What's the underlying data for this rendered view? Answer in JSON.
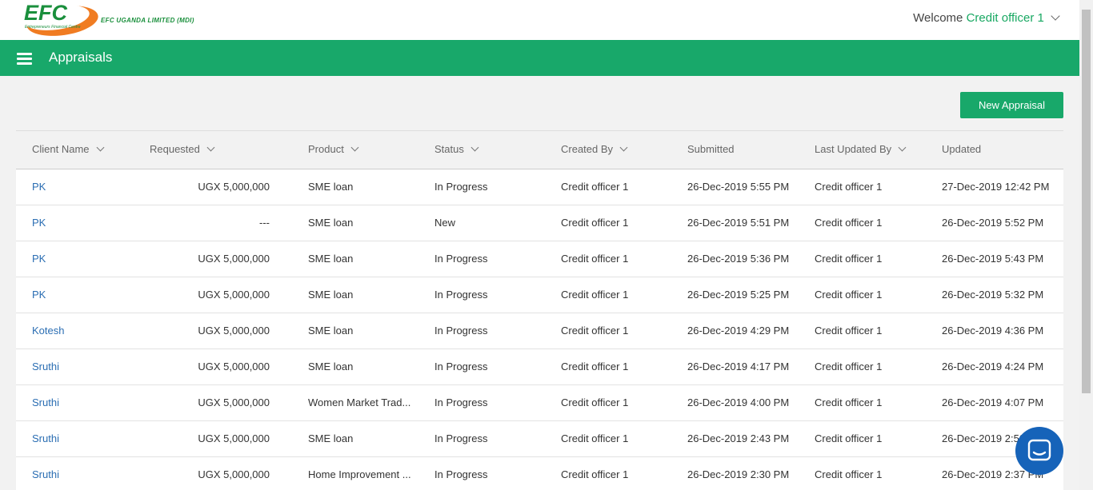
{
  "header": {
    "logo_mark": "EFC",
    "logo_tagline": "Entrepreneurs Financial Centre",
    "company_name": "EFC UGANDA LIMITED (MDI)",
    "welcome_label": "Welcome",
    "user_name": "Credit officer 1"
  },
  "nav": {
    "title": "Appraisals"
  },
  "toolbar": {
    "new_appraisal_label": "New Appraisal"
  },
  "table": {
    "columns": [
      {
        "label": "Client Name",
        "sortable": true
      },
      {
        "label": "Requested",
        "sortable": true
      },
      {
        "label": "Product",
        "sortable": true
      },
      {
        "label": "Status",
        "sortable": true
      },
      {
        "label": "Created By",
        "sortable": true
      },
      {
        "label": "Submitted",
        "sortable": false
      },
      {
        "label": "Last Updated By",
        "sortable": true
      },
      {
        "label": "Updated",
        "sortable": false
      }
    ],
    "rows": [
      {
        "client": "PK",
        "requested": "UGX 5,000,000",
        "product": "SME loan",
        "status": "In Progress",
        "created_by": "Credit officer 1",
        "submitted": "26-Dec-2019 5:55 PM",
        "last_updated_by": "Credit officer 1",
        "updated": "27-Dec-2019 12:42 PM"
      },
      {
        "client": "PK",
        "requested": "---",
        "product": "SME loan",
        "status": "New",
        "created_by": "Credit officer 1",
        "submitted": "26-Dec-2019 5:51 PM",
        "last_updated_by": "Credit officer 1",
        "updated": "26-Dec-2019 5:52 PM"
      },
      {
        "client": "PK",
        "requested": "UGX 5,000,000",
        "product": "SME loan",
        "status": "In Progress",
        "created_by": "Credit officer 1",
        "submitted": "26-Dec-2019 5:36 PM",
        "last_updated_by": "Credit officer 1",
        "updated": "26-Dec-2019 5:43 PM"
      },
      {
        "client": "PK",
        "requested": "UGX 5,000,000",
        "product": "SME loan",
        "status": "In Progress",
        "created_by": "Credit officer 1",
        "submitted": "26-Dec-2019 5:25 PM",
        "last_updated_by": "Credit officer 1",
        "updated": "26-Dec-2019 5:32 PM"
      },
      {
        "client": "Kotesh",
        "requested": "UGX 5,000,000",
        "product": "SME loan",
        "status": "In Progress",
        "created_by": "Credit officer 1",
        "submitted": "26-Dec-2019 4:29 PM",
        "last_updated_by": "Credit officer 1",
        "updated": "26-Dec-2019 4:36 PM"
      },
      {
        "client": "Sruthi",
        "requested": "UGX 5,000,000",
        "product": "SME loan",
        "status": "In Progress",
        "created_by": "Credit officer 1",
        "submitted": "26-Dec-2019 4:17 PM",
        "last_updated_by": "Credit officer 1",
        "updated": "26-Dec-2019 4:24 PM"
      },
      {
        "client": "Sruthi",
        "requested": "UGX 5,000,000",
        "product": "Women Market Trad...",
        "status": "In Progress",
        "created_by": "Credit officer 1",
        "submitted": "26-Dec-2019 4:00 PM",
        "last_updated_by": "Credit officer 1",
        "updated": "26-Dec-2019 4:07 PM"
      },
      {
        "client": "Sruthi",
        "requested": "UGX 5,000,000",
        "product": "SME loan",
        "status": "In Progress",
        "created_by": "Credit officer 1",
        "submitted": "26-Dec-2019 2:43 PM",
        "last_updated_by": "Credit officer 1",
        "updated": "26-Dec-2019 2:50 PM"
      },
      {
        "client": "Sruthi",
        "requested": "UGX 5,000,000",
        "product": "Home Improvement ...",
        "status": "In Progress",
        "created_by": "Credit officer 1",
        "submitted": "26-Dec-2019 2:30 PM",
        "last_updated_by": "Credit officer 1",
        "updated": "26-Dec-2019 2:37 PM"
      }
    ]
  },
  "colors": {
    "brand_green": "#18a86a",
    "link_blue": "#2b6eb3",
    "chat_blue": "#1663b9",
    "logo_orange": "#f07c22"
  },
  "icons": {
    "menu": "hamburger-icon",
    "chat": "chat-icon",
    "dropdown": "chevron-down-icon"
  }
}
